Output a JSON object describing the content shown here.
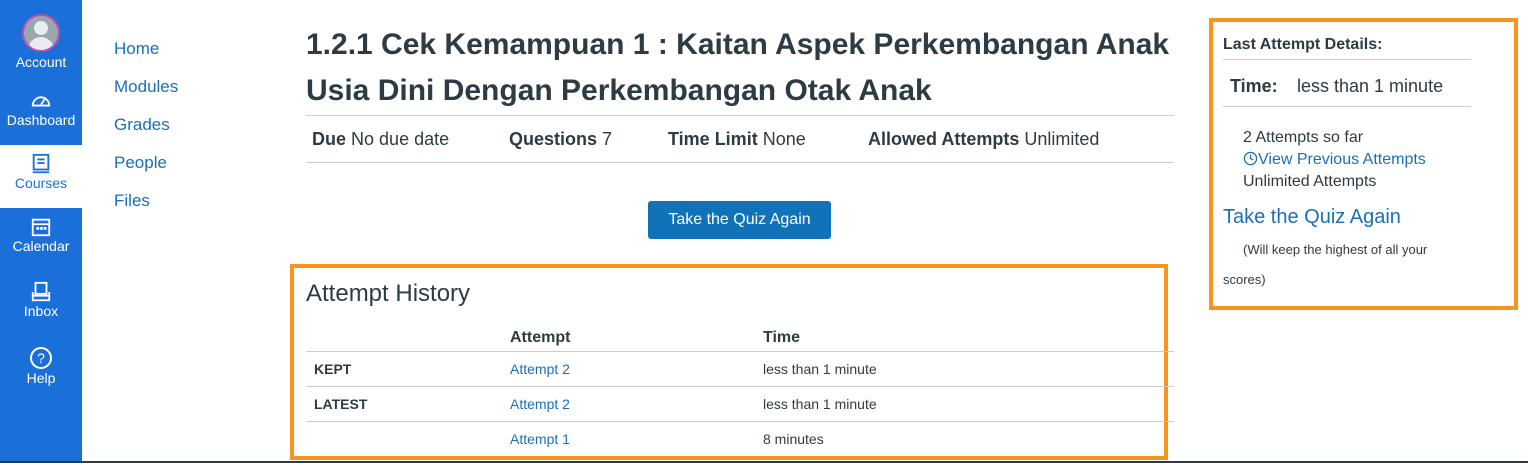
{
  "global_nav": {
    "account": "Account",
    "dashboard": "Dashboard",
    "courses": "Courses",
    "calendar": "Calendar",
    "inbox": "Inbox",
    "help": "Help"
  },
  "course_nav": [
    "Home",
    "Modules",
    "Grades",
    "People",
    "Files"
  ],
  "quiz": {
    "title": "1.2.1 Cek Kemampuan 1 : Kaitan Aspek Perkembangan Anak Usia Dini Dengan Perkembangan Otak Anak",
    "due_label": "Due",
    "due_value": "No due date",
    "questions_label": "Questions",
    "questions_value": "7",
    "time_limit_label": "Time Limit",
    "time_limit_value": "None",
    "allowed_label": "Allowed Attempts",
    "allowed_value": "Unlimited",
    "retake_button": "Take the Quiz Again"
  },
  "attempt_history": {
    "title": "Attempt History",
    "columns": [
      "",
      "Attempt",
      "Time"
    ],
    "rows": [
      {
        "status": "KEPT",
        "attempt": "Attempt 2",
        "time": "less than 1 minute"
      },
      {
        "status": "LATEST",
        "attempt": "Attempt 2",
        "time": "less than 1 minute"
      },
      {
        "status": "",
        "attempt": "Attempt 1",
        "time": "8 minutes"
      }
    ]
  },
  "sidebar": {
    "heading": "Last Attempt Details:",
    "time_label": "Time:",
    "time_value": "less than 1 minute",
    "attempts_so_far": "2 Attempts so far",
    "view_previous": "View Previous Attempts",
    "unlimited": "Unlimited Attempts",
    "retake_link": "Take the Quiz Again",
    "note_line1": "(Will keep the highest of all your",
    "note_line2": "scores)"
  },
  "colors": {
    "nav_bg": "#1b6fd8",
    "link": "#1b6fb8",
    "button": "#1072b8",
    "highlight": "#f7941d"
  }
}
